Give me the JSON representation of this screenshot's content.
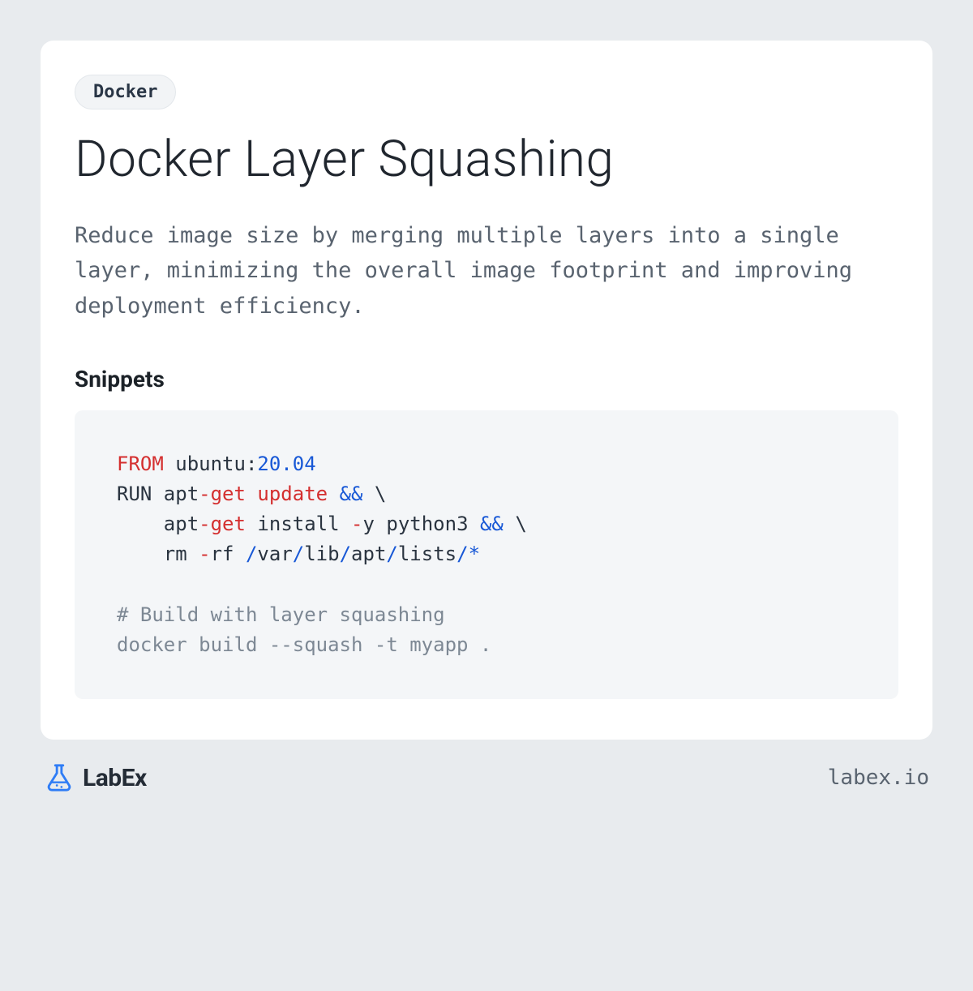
{
  "tag": "Docker",
  "title": "Docker Layer Squashing",
  "description": "Reduce image size by merging multiple layers into a single layer, minimizing the overall image footprint and improving deployment efficiency.",
  "snippets_heading": "Snippets",
  "code": {
    "tokens": [
      {
        "t": "FROM",
        "c": "keyword"
      },
      {
        "t": " ubuntu:"
      },
      {
        "t": "20.04",
        "c": "number"
      },
      {
        "t": "\n"
      },
      {
        "t": "RUN apt"
      },
      {
        "t": "-",
        "c": "op-red"
      },
      {
        "t": "get update",
        "c": "op-red"
      },
      {
        "t": " "
      },
      {
        "t": "&&",
        "c": "op-blue"
      },
      {
        "t": " \\"
      },
      {
        "t": "\n"
      },
      {
        "t": "    apt"
      },
      {
        "t": "-",
        "c": "op-red"
      },
      {
        "t": "get",
        "c": "op-red"
      },
      {
        "t": " install "
      },
      {
        "t": "-",
        "c": "op-red"
      },
      {
        "t": "y python3 "
      },
      {
        "t": "&&",
        "c": "op-blue"
      },
      {
        "t": " \\"
      },
      {
        "t": "\n"
      },
      {
        "t": "    rm "
      },
      {
        "t": "-",
        "c": "op-red"
      },
      {
        "t": "rf "
      },
      {
        "t": "/",
        "c": "slash"
      },
      {
        "t": "var"
      },
      {
        "t": "/",
        "c": "slash"
      },
      {
        "t": "lib"
      },
      {
        "t": "/",
        "c": "slash"
      },
      {
        "t": "apt"
      },
      {
        "t": "/",
        "c": "slash"
      },
      {
        "t": "lists"
      },
      {
        "t": "/",
        "c": "slash"
      },
      {
        "t": "*",
        "c": "op-blue"
      },
      {
        "t": "\n"
      },
      {
        "t": "\n"
      },
      {
        "t": "# Build with layer squashing",
        "c": "comment"
      },
      {
        "t": "\n"
      },
      {
        "t": "docker build --squash -t myapp .",
        "c": "comment"
      }
    ]
  },
  "brand": {
    "name": "LabEx",
    "url": "labex.io"
  },
  "colors": {
    "page_bg": "#e8ebee",
    "card_bg": "#ffffff",
    "code_bg": "#f4f6f8",
    "accent_blue": "#2e7cf6"
  }
}
